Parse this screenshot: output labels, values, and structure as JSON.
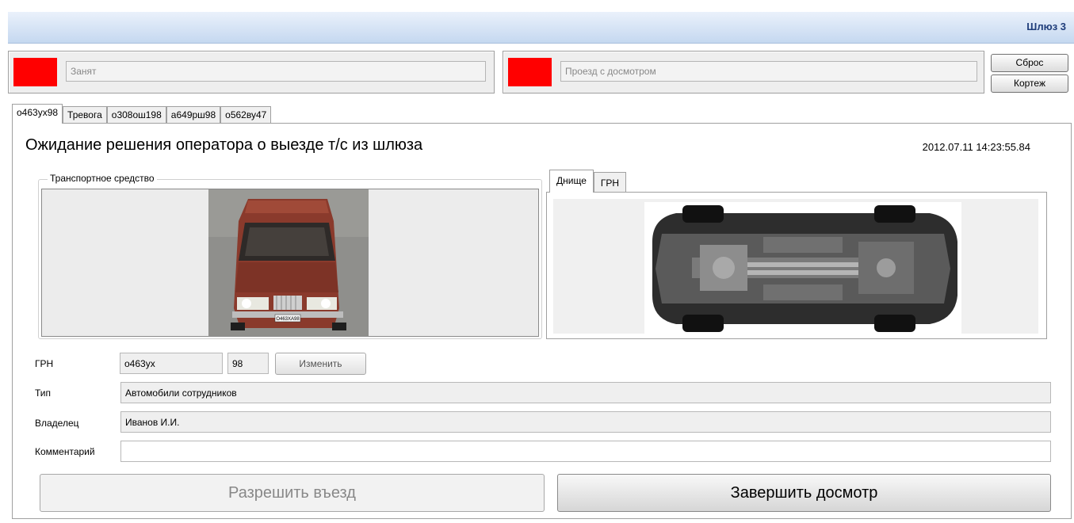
{
  "header": {
    "title": "Шлюз 3"
  },
  "status": {
    "left_text": "Занят",
    "right_text": "Проезд с досмотром",
    "indicator_color": "#ff0000"
  },
  "buttons": {
    "reset": "Сброс",
    "cortege": "Кортеж"
  },
  "tabs": [
    {
      "label": "о463ух98"
    },
    {
      "label": "Тревога"
    },
    {
      "label": "о308ош198"
    },
    {
      "label": "а649рш98"
    },
    {
      "label": "о562ву47"
    }
  ],
  "main": {
    "title": "Ожидание решения оператора о выезде т/с из шлюза",
    "timestamp": "2012.07.11 14:23:55.84",
    "vehicle_group_label": "Транспортное средство",
    "vehicle_plate_visible": "О463ХА98"
  },
  "subtabs": [
    {
      "label": "Днище"
    },
    {
      "label": "ГРН"
    }
  ],
  "form": {
    "grn_label": "ГРН",
    "grn_value": "о463ух",
    "region_value": "98",
    "change_button": "Изменить",
    "type_label": "Тип",
    "type_value": "Автомобили сотрудников",
    "owner_label": "Владелец",
    "owner_value": "Иванов И.И.",
    "comment_label": "Комментарий",
    "comment_value": ""
  },
  "actions": {
    "allow": "Разрешить въезд",
    "finish": "Завершить досмотр"
  }
}
